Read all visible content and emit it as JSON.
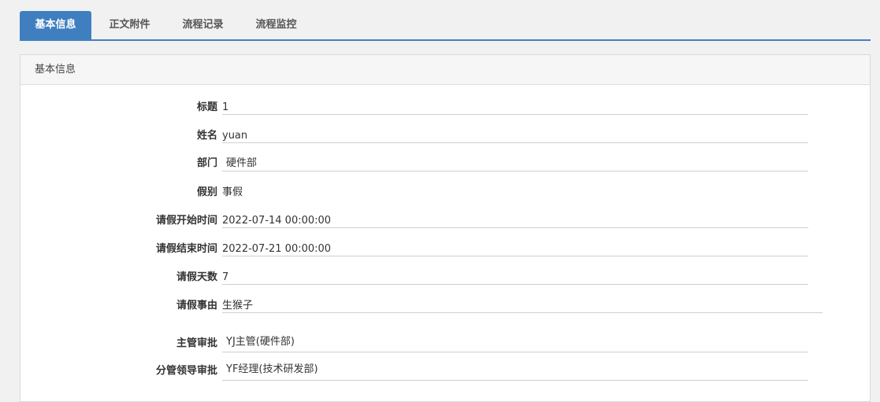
{
  "tabs": [
    {
      "label": "基本信息",
      "active": true
    },
    {
      "label": "正文附件",
      "active": false
    },
    {
      "label": "流程记录",
      "active": false
    },
    {
      "label": "流程监控",
      "active": false
    }
  ],
  "panel": {
    "title": "基本信息"
  },
  "fields": {
    "title": {
      "label": "标题",
      "value": "1"
    },
    "name": {
      "label": "姓名",
      "value": "yuan"
    },
    "department": {
      "label": "部门",
      "value": "硬件部"
    },
    "leave_type": {
      "label": "假别",
      "value": "事假"
    },
    "start_time": {
      "label": "请假开始时间",
      "value": "2022-07-14 00:00:00"
    },
    "end_time": {
      "label": "请假结束时间",
      "value": "2022-07-21 00:00:00"
    },
    "days": {
      "label": "请假天数",
      "value": "7"
    },
    "reason": {
      "label": "请假事由",
      "value": "生猴子"
    },
    "supervisor": {
      "label": "主管审批",
      "value": "YJ主管(硬件部)"
    },
    "leader": {
      "label": "分管领导审批",
      "value": "YF经理(技术研发部)"
    }
  },
  "colors": {
    "accent": "#3f7fc0"
  }
}
